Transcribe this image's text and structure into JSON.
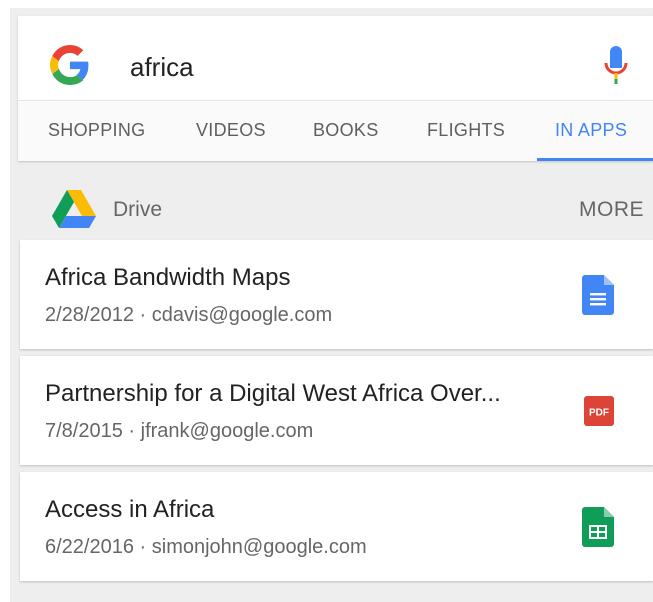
{
  "search": {
    "query": "africa"
  },
  "tabs": [
    {
      "label": "SHOPPING"
    },
    {
      "label": "VIDEOS"
    },
    {
      "label": "BOOKS"
    },
    {
      "label": "FLIGHTS"
    },
    {
      "label": "IN APPS",
      "active": true
    }
  ],
  "drive_section": {
    "label": "Drive",
    "more_label": "MORE"
  },
  "results": [
    {
      "title": "Africa Bandwidth Maps",
      "subtitle": "2/28/2012 · cdavis@google.com",
      "icon": "google-docs-icon",
      "color": "#4285f4"
    },
    {
      "title": "Partnership for a Digital West Africa Over...",
      "subtitle": "7/8/2015 · jfrank@google.com",
      "icon": "pdf-icon",
      "icon_text": "PDF",
      "color": "#db4437"
    },
    {
      "title": "Access in Africa",
      "subtitle": "6/22/2016 · simonjohn@google.com",
      "icon": "google-sheets-icon",
      "color": "#0f9d58"
    }
  ],
  "colors": {
    "accent": "#4285f4",
    "background": "#eeeeee"
  }
}
